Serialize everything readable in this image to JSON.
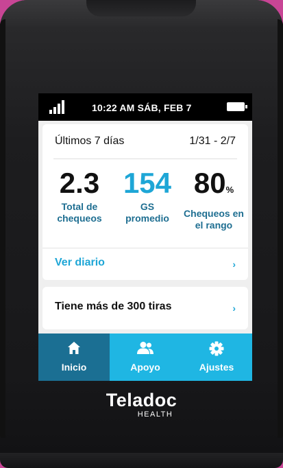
{
  "status": {
    "time_date": "10:22 AM   SÁB, FEB 7"
  },
  "summary": {
    "period": "Últimos 7 días",
    "range": "1/31 - 2/7",
    "stats": [
      {
        "value": "2.3",
        "unit": "",
        "label_line1": "Total de",
        "label_line2": "chequeos"
      },
      {
        "value": "154",
        "unit": "",
        "label_line1": "GS",
        "label_line2": "promedio"
      },
      {
        "value": "80",
        "unit": "%",
        "label_line1": "Chequeos en",
        "label_line2": "el rango"
      }
    ],
    "diary_link": "Ver diario",
    "chevron": "›"
  },
  "strips": {
    "text": "Tiene más de 300 tiras",
    "chevron": "›"
  },
  "tabs": [
    {
      "label": "Inicio",
      "icon": "home-icon",
      "active": true
    },
    {
      "label": "Apoyo",
      "icon": "people-icon",
      "active": false
    },
    {
      "label": "Ajustes",
      "icon": "gear-icon",
      "active": false
    }
  ],
  "brand": {
    "name": "Teladoc",
    "sub": "HEALTH"
  },
  "colors": {
    "accent": "#1fb6e3",
    "active_tab": "#1b6f93",
    "stat_label": "#1e6e91",
    "background": "#c84595"
  }
}
